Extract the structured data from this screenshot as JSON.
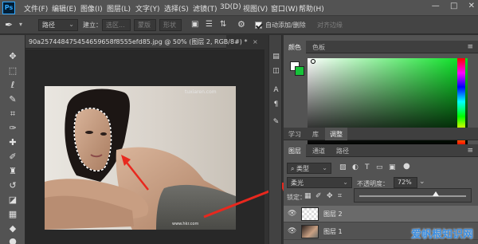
{
  "app": {
    "logo": "Ps"
  },
  "menubar": {
    "items": [
      "文件(F)",
      "编辑(E)",
      "图像(I)",
      "图层(L)",
      "文字(Y)",
      "选择(S)",
      "滤镜(T)",
      "3D(D)",
      "视图(V)",
      "窗口(W)",
      "帮助(H)"
    ],
    "window_controls": [
      "—",
      "□",
      "✕"
    ]
  },
  "optionsbar": {
    "mode_select": "路径",
    "make_label": "建立：",
    "selection_button": "选区...",
    "mask_button": "蒙版",
    "shape_button": "形状",
    "auto_add_delete": "自动添加/删除",
    "align_edges": "对齐边缘"
  },
  "document": {
    "tab_title": "90a257448475454659658f8555efd85.jpg @ 50% (图层 2, RGB/8#) *",
    "close": "×",
    "photo_watermark": "tuxiaren.com",
    "photo_credit": "www.hkr.com"
  },
  "panels": {
    "color_tabs": [
      "颜色",
      "色板"
    ],
    "adjust_tabs": [
      "学习",
      "库",
      "调整"
    ],
    "layers_tabs": [
      "图层",
      "通道",
      "路径"
    ],
    "filter_kind": "类型",
    "blend_mode": "柔光",
    "opacity_label": "不透明度：",
    "opacity_value": "72%",
    "lock_label": "锁定：",
    "layers": [
      {
        "name": "图层 2"
      },
      {
        "name": "图层 1"
      }
    ],
    "colors": {
      "foreground": "#ffffff",
      "background": "#17c33a"
    }
  },
  "site_watermark": "爱帆根知识网"
}
